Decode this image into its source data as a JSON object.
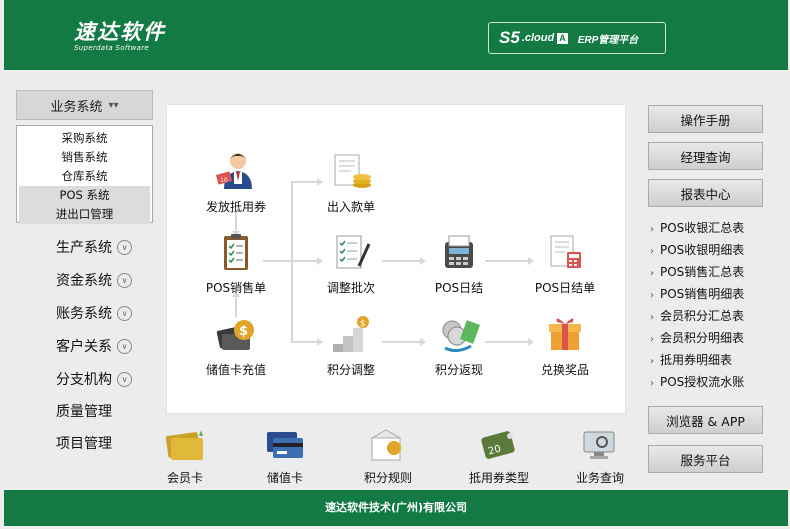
{
  "header": {
    "logo_main": "速达软件",
    "logo_sub": "Superdata Software",
    "s5": "S5",
    "cloud": ".cloud",
    "a_mark": "A",
    "erp": "ERP管理平台"
  },
  "sidebar": {
    "business_header": "业务系统",
    "business_items": [
      "采购系统",
      "销售系统",
      "仓库系统",
      "POS 系统",
      "进出口管理"
    ],
    "items": [
      "生产系统",
      "资金系统",
      "账务系统",
      "客户关系",
      "分支机构",
      "质量管理",
      "项目管理"
    ]
  },
  "flow": {
    "issue_voucher": "发放抵用券",
    "pos_sales": "POS销售单",
    "card_recharge": "储值卡充值",
    "cash_io": "出入款单",
    "adjust_batch": "调整批次",
    "points_adjust": "积分调整",
    "pos_daily": "POS日结",
    "points_rebate": "积分返现",
    "pos_daily_bill": "POS日结单",
    "redeem_prize": "兑换奖品"
  },
  "bottom": [
    "会员卡",
    "储值卡",
    "积分规则",
    "抵用券类型",
    "业务查询"
  ],
  "right": {
    "manual": "操作手册",
    "manager_query": "经理查询",
    "report_center": "报表中心",
    "reports": [
      "POS收银汇总表",
      "POS收银明细表",
      "POS销售汇总表",
      "POS销售明细表",
      "会员积分汇总表",
      "会员积分明细表",
      "抵用券明细表",
      "POS授权流水账"
    ],
    "browser_app": "浏览器 & APP",
    "service_platform": "服务平台"
  },
  "footer": "速达软件技术(广州)有限公司",
  "colors": {
    "brand_green": "#137a44"
  }
}
